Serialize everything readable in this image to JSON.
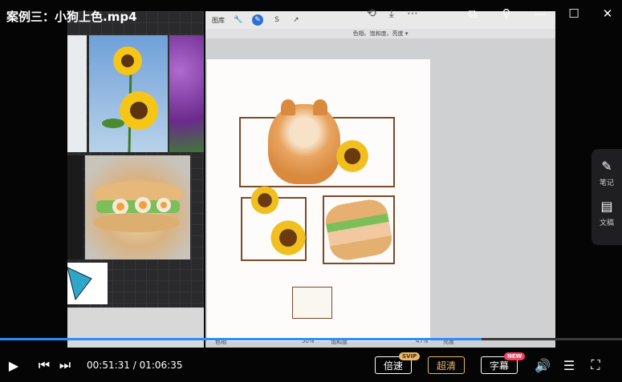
{
  "video": {
    "title": "案例三：小狗上色.mp4",
    "current_time": "00:51:31",
    "total_time": "01:06:35",
    "progress": 0.7736
  },
  "app": {
    "gallery_label": "图库",
    "adjust_label": "色相、饱和度、亮度",
    "sliders": [
      {
        "label": "色相",
        "value": "50%"
      },
      {
        "label": "饱和度",
        "value": "47%"
      },
      {
        "label": "亮度",
        "value": ""
      }
    ]
  },
  "side_panel": {
    "items": [
      {
        "icon": "notes-icon",
        "label": "笔记"
      },
      {
        "icon": "document-icon",
        "label": "文稿"
      }
    ]
  },
  "controls": {
    "speed_label": "倍速",
    "speed_badge": "SVIP",
    "quality_label": "超清",
    "subtitle_label": "字幕",
    "subtitle_badge": "NEW"
  },
  "colors": {
    "accent": "#2a8cff",
    "gold": "#e8b86a",
    "badge_new": "#ff3d5a"
  }
}
